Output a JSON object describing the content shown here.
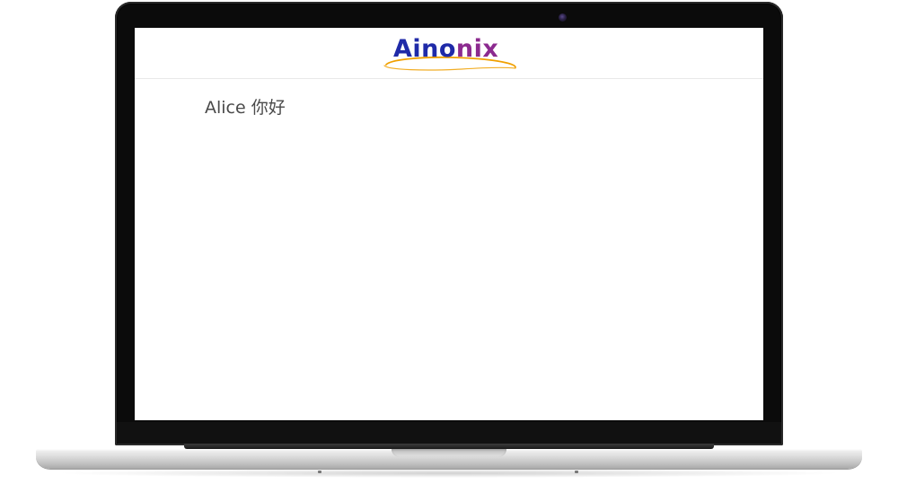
{
  "app": {
    "logo": {
      "text_part1": "Aino",
      "text_part2": "nix",
      "color_primary": "#1f2aa8",
      "color_secondary": "#8c2a8f",
      "swoosh_color": "#f0a000"
    }
  },
  "content": {
    "greeting": "Alice 你好"
  },
  "device": {
    "frame": "laptop",
    "camera_icon": "webcam-icon"
  }
}
